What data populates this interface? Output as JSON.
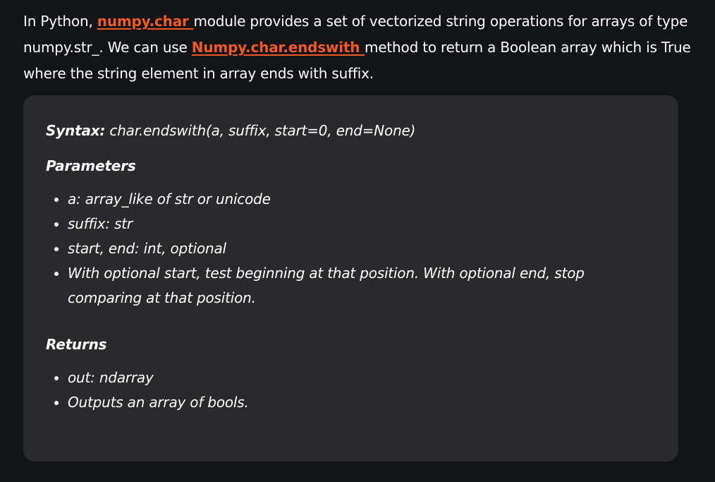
{
  "intro": {
    "text_1": "In Python, ",
    "link_1": "numpy.char ",
    "text_2": "module provides a set of vectorized string operations for arrays of type numpy.str_. We can use ",
    "link_2": "Numpy.char.endswith ",
    "text_3": "method to return a Boolean array which is True where the string element in array ends with suffix."
  },
  "syntax": {
    "label": "Syntax:",
    "signature": " char.endswith(a, suffix, start=0, end=None)"
  },
  "parameters": {
    "heading": "Parameters",
    "items": [
      "a: array_like of str or unicode",
      "suffix: str",
      "start, end: int, optional",
      "With optional start, test beginning at that position. With optional end, stop comparing at that position."
    ]
  },
  "returns": {
    "heading": "Returns",
    "items": [
      "out: ndarray",
      "Outputs an array of bools."
    ]
  },
  "colors": {
    "background": "#131417",
    "box": "#2a2a2d",
    "link": "#f15a24",
    "text": "#ffffff"
  }
}
